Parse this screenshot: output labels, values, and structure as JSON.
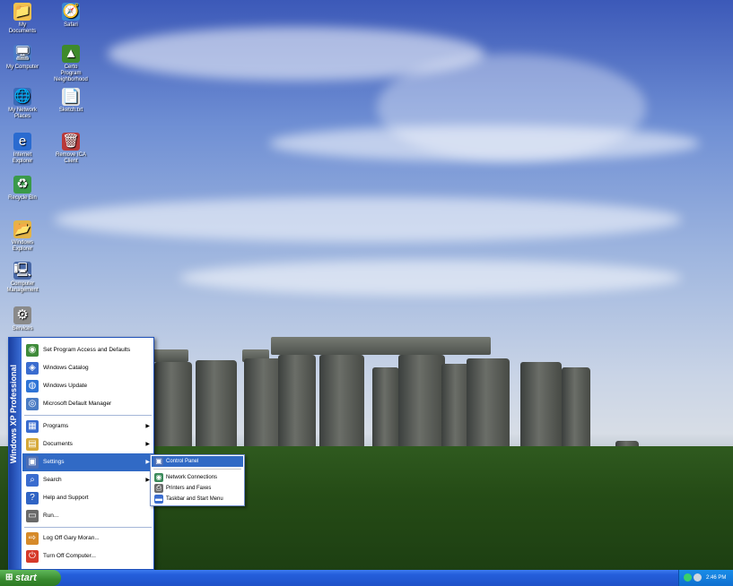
{
  "desktop_icons": [
    {
      "name": "mydocs-icon",
      "label": "My Documents",
      "glyph": "📁",
      "color": "#f2c14e"
    },
    {
      "name": "safari-icon",
      "label": "Safari",
      "glyph": "🧭",
      "color": "#3a88d6"
    },
    {
      "name": "mycomputer-icon",
      "label": "My Computer",
      "glyph": "🖥",
      "color": "#4a7ac7"
    },
    {
      "name": "gettingstarted-icon",
      "label": "Certo Program Neighborhood",
      "glyph": "▲",
      "color": "#3e8a2c"
    },
    {
      "name": "network-icon",
      "label": "My Network Places",
      "glyph": "🌐",
      "color": "#3a6bb8"
    },
    {
      "name": "notepad-icon",
      "label": "Sketch.txt",
      "glyph": "📄",
      "color": "#e8e8e8"
    },
    {
      "name": "ie-icon",
      "label": "Internet Explorer",
      "glyph": "e",
      "color": "#2a6bd0"
    },
    {
      "name": "remove-icon",
      "label": "Remove ICA Client",
      "glyph": "🗑",
      "color": "#b83a3a"
    },
    {
      "name": "recycle-icon",
      "label": "Recycle Bin",
      "glyph": "♻",
      "color": "#3a9a4a"
    },
    {
      "name": "explorer-icon",
      "label": "Windows Explorer",
      "glyph": "📂",
      "color": "#e3b447"
    },
    {
      "name": "compmgmt-icon",
      "label": "Computer Management",
      "glyph": "🖳",
      "color": "#4a6aa8"
    },
    {
      "name": "services-icon",
      "label": "Services",
      "glyph": "⚙",
      "color": "#8a8a8a"
    }
  ],
  "start_menu": {
    "band_text": "Windows XP Professional",
    "top_items": [
      {
        "label": "Set Program Access and Defaults",
        "glyph": "◉",
        "color": "#3f8b3a"
      },
      {
        "label": "Windows Catalog",
        "glyph": "◈",
        "color": "#3a6ccf"
      },
      {
        "label": "Windows Update",
        "glyph": "◍",
        "color": "#2f74d6"
      },
      {
        "label": "Microsoft Default Manager",
        "glyph": "◎",
        "color": "#4a7cc4"
      }
    ],
    "main_items": [
      {
        "label": "Programs",
        "glyph": "▦",
        "color": "#3a6ccf",
        "arrow": "▶"
      },
      {
        "label": "Documents",
        "glyph": "▤",
        "color": "#d6a93a",
        "arrow": "▶"
      },
      {
        "label": "Settings",
        "glyph": "▣",
        "color": "#4c6fb5",
        "arrow": "▶",
        "highlight": true
      },
      {
        "label": "Search",
        "glyph": "⌕",
        "color": "#3a6ccf",
        "arrow": "▶"
      },
      {
        "label": "Help and Support",
        "glyph": "?",
        "color": "#2f63c4",
        "arrow": ""
      },
      {
        "label": "Run...",
        "glyph": "▭",
        "color": "#6a6a6a",
        "arrow": ""
      }
    ],
    "bottom_items": [
      {
        "label": "Log Off Gary Moran...",
        "glyph": "⇨",
        "color": "#d68a2a"
      },
      {
        "label": "Turn Off Computer...",
        "glyph": "⏻",
        "color": "#d63a2a"
      }
    ]
  },
  "settings_submenu": {
    "items": [
      {
        "label": "Control Panel",
        "glyph": "▣",
        "color": "#4c6fb5",
        "highlight": true
      },
      {
        "label": "Network Connections",
        "glyph": "◉",
        "color": "#3a8a5a"
      },
      {
        "label": "Printers and Faxes",
        "glyph": "⎙",
        "color": "#6a6a6a"
      },
      {
        "label": "Taskbar and Start Menu",
        "glyph": "▬",
        "color": "#3a6ccf"
      }
    ]
  },
  "taskbar": {
    "start_label": "start",
    "clock": "2:46 PM"
  }
}
